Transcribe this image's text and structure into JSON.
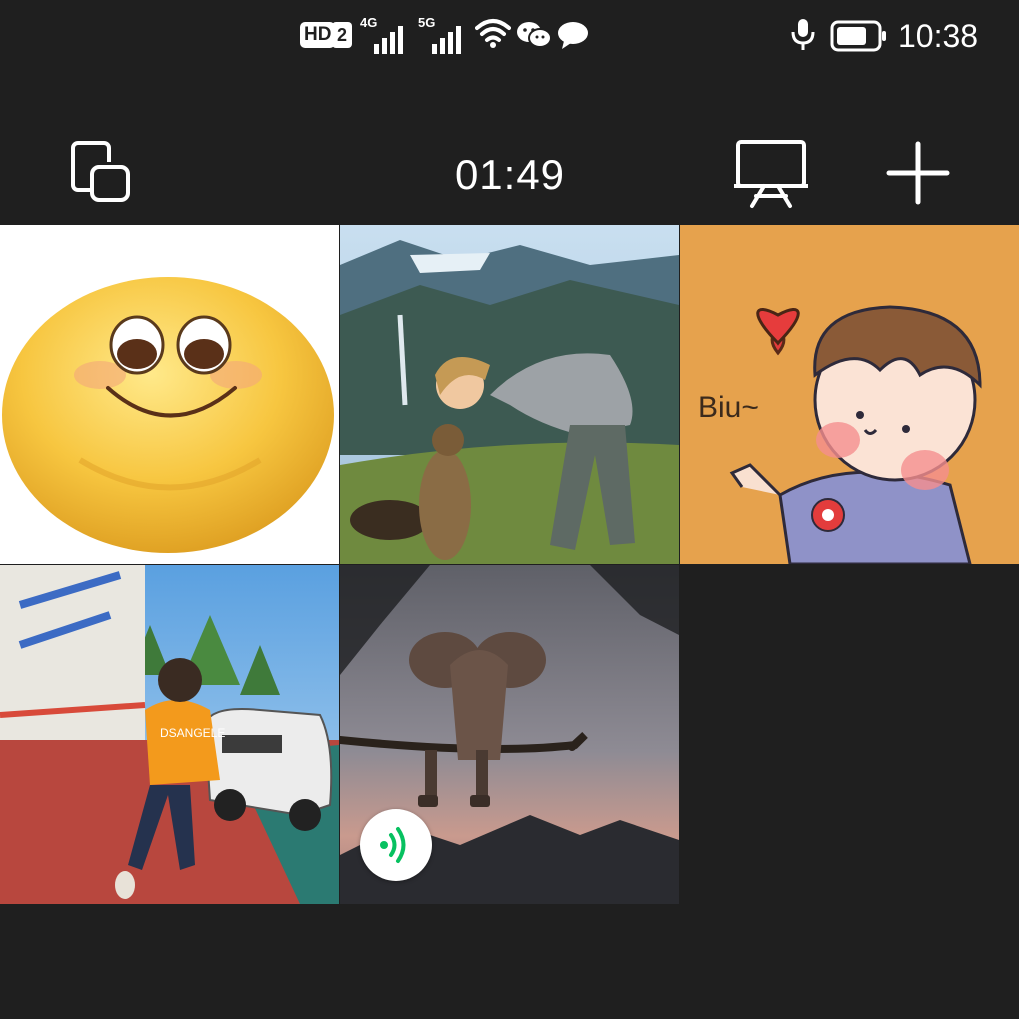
{
  "status_bar": {
    "hd_label": "HD",
    "sim_slot": "2",
    "network_1": "4G",
    "network_2": "5G",
    "time": "10:38",
    "icons": [
      "hd-icon",
      "signal-4g-icon",
      "signal-5g-icon",
      "wifi-icon",
      "wechat-icon",
      "message-icon",
      "microphone-icon",
      "battery-icon"
    ]
  },
  "toolbar": {
    "call_duration": "01:49",
    "icons": [
      "switch-window-icon",
      "screen-share-icon",
      "add-participant-icon"
    ]
  },
  "participants": [
    {
      "avatar": "smiling emoji",
      "speaking": false
    },
    {
      "avatar": "boy with marmot on mountain",
      "speaking": false
    },
    {
      "avatar": "cartoon boy with heart",
      "caption": "Biu~",
      "speaking": false
    },
    {
      "avatar": "person in orange hoodie by car",
      "shirt_text": "DSANGELE",
      "speaking": false
    },
    {
      "avatar": "elephant on branch at dusk",
      "speaking": true
    }
  ],
  "colors": {
    "background": "#1f1f1f",
    "tile_orange": "#e6a24d",
    "speaking_green": "#07c160"
  }
}
